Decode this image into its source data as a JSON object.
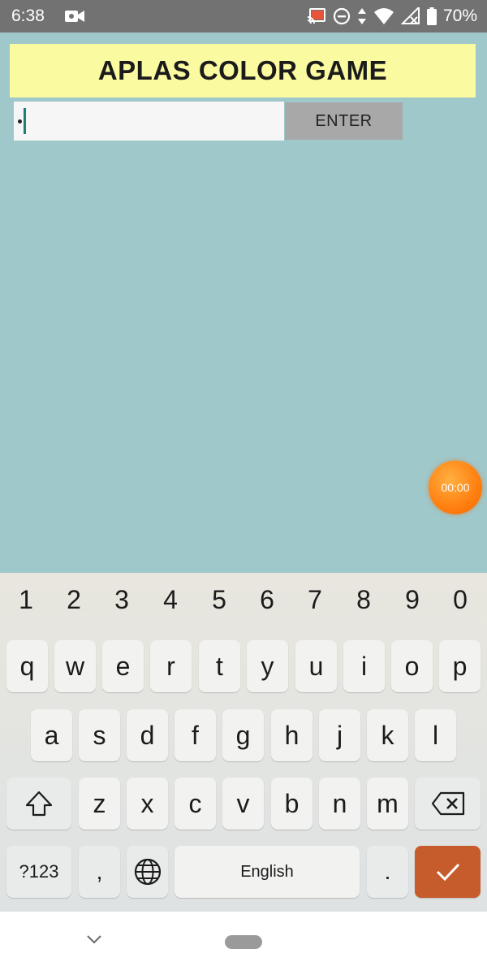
{
  "status_bar": {
    "time": "6:38",
    "battery": "70%",
    "icons": [
      "video-camera-icon",
      "cast-icon",
      "do-not-disturb-icon",
      "data-arrows-icon",
      "wifi-icon",
      "signal-no-data-icon",
      "battery-icon"
    ]
  },
  "app": {
    "title": "APLAS COLOR GAME",
    "input_value": "",
    "enter_label": "ENTER",
    "timer": "00:00"
  },
  "keyboard": {
    "number_row": [
      "1",
      "2",
      "3",
      "4",
      "5",
      "6",
      "7",
      "8",
      "9",
      "0"
    ],
    "row1": [
      "q",
      "w",
      "e",
      "r",
      "t",
      "y",
      "u",
      "i",
      "o",
      "p"
    ],
    "row2": [
      "a",
      "s",
      "d",
      "f",
      "g",
      "h",
      "j",
      "k",
      "l"
    ],
    "row3": [
      "z",
      "x",
      "c",
      "v",
      "b",
      "n",
      "m"
    ],
    "symbols_label": "?123",
    "comma_label": ",",
    "space_label": "English",
    "period_label": ".",
    "accent_color": "#c65b2c"
  },
  "colors": {
    "background": "#9fc8cb",
    "title_bg": "#fafaa0",
    "timer": "#ff7f10"
  }
}
